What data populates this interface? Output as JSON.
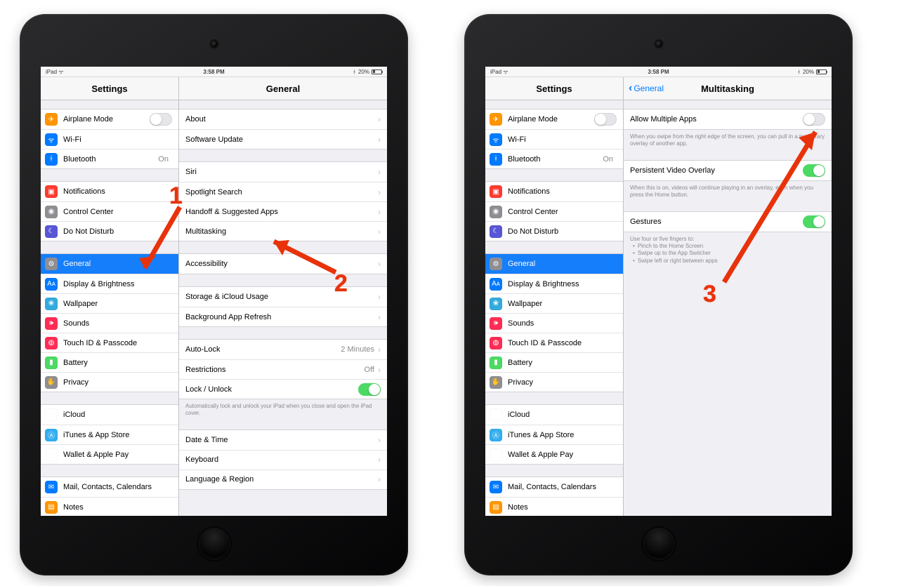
{
  "status": {
    "device": "iPad",
    "wifi": "ᯤ",
    "time": "3:58 PM",
    "bt": "ᚼ",
    "battPct": "20%"
  },
  "navA": {
    "left": "Settings",
    "right": "General"
  },
  "navB": {
    "left": "Settings",
    "backLabel": "General",
    "right": "Multitasking"
  },
  "sidebar": {
    "g1": [
      {
        "label": "Airplane Mode",
        "toggle": "off",
        "iconCls": "i-orange",
        "glyph": "✈"
      },
      {
        "label": "Wi-Fi",
        "iconCls": "i-blue",
        "glyph": "ᯤ"
      },
      {
        "label": "Bluetooth",
        "value": "On",
        "iconCls": "i-blue",
        "glyph": "ᚼ"
      }
    ],
    "g2": [
      {
        "label": "Notifications",
        "iconCls": "i-red",
        "glyph": "▣"
      },
      {
        "label": "Control Center",
        "iconCls": "i-grey",
        "glyph": "◉"
      },
      {
        "label": "Do Not Disturb",
        "iconCls": "i-purple",
        "glyph": "☾"
      }
    ],
    "g3": [
      {
        "label": "General",
        "selected": true,
        "iconCls": "i-grey",
        "glyph": "⚙"
      },
      {
        "label": "Display & Brightness",
        "iconCls": "i-blue",
        "glyph": "Aᴀ"
      },
      {
        "label": "Wallpaper",
        "iconCls": "i-teal",
        "glyph": "❀"
      },
      {
        "label": "Sounds",
        "iconCls": "i-pink",
        "glyph": "🕪"
      },
      {
        "label": "Touch ID & Passcode",
        "iconCls": "i-pink",
        "glyph": "◍"
      },
      {
        "label": "Battery",
        "iconCls": "i-green",
        "glyph": "▮"
      },
      {
        "label": "Privacy",
        "iconCls": "i-grey",
        "glyph": "✋"
      }
    ],
    "g4": [
      {
        "label": "iCloud",
        "iconCls": "i-white",
        "glyph": "☁"
      },
      {
        "label": "iTunes & App Store",
        "iconCls": "i-ltblue",
        "glyph": "Ⓐ"
      },
      {
        "label": "Wallet & Apple Pay",
        "iconCls": "i-white",
        "glyph": "▭"
      }
    ],
    "g5": [
      {
        "label": "Mail, Contacts, Calendars",
        "iconCls": "i-blue",
        "glyph": "✉"
      },
      {
        "label": "Notes",
        "iconCls": "i-orange",
        "glyph": "▤"
      }
    ]
  },
  "generalPane": {
    "g1": [
      "About",
      "Software Update"
    ],
    "g2": [
      "Siri",
      "Spotlight Search",
      "Handoff & Suggested Apps",
      "Multitasking"
    ],
    "g3": [
      "Accessibility"
    ],
    "g4": [
      "Storage & iCloud Usage",
      "Background App Refresh"
    ],
    "g5": [
      {
        "label": "Auto-Lock",
        "value": "2 Minutes"
      },
      {
        "label": "Restrictions",
        "value": "Off"
      },
      {
        "label": "Lock / Unlock",
        "toggle": "on"
      }
    ],
    "g5foot": "Automatically lock and unlock your iPad when you close and open the iPad cover.",
    "g6": [
      "Date & Time",
      "Keyboard",
      "Language & Region"
    ]
  },
  "multitaskPane": {
    "r1": {
      "label": "Allow Multiple Apps",
      "toggle": "off"
    },
    "r1foot": "When you swipe from the right edge of the screen, you can pull in a temporary overlay of another app.",
    "r2": {
      "label": "Persistent Video Overlay",
      "toggle": "on"
    },
    "r2foot": "When this is on, videos will continue playing in an overlay, even when you press the Home button.",
    "r3": {
      "label": "Gestures",
      "toggle": "on"
    },
    "r3foot": {
      "lead": "Use four or five fingers to:",
      "items": [
        "Pinch to the Home Screen",
        "Swipe up to the App Switcher",
        "Swipe left or right between apps"
      ]
    }
  },
  "annotations": {
    "n1": "1",
    "n2": "2",
    "n3": "3"
  }
}
